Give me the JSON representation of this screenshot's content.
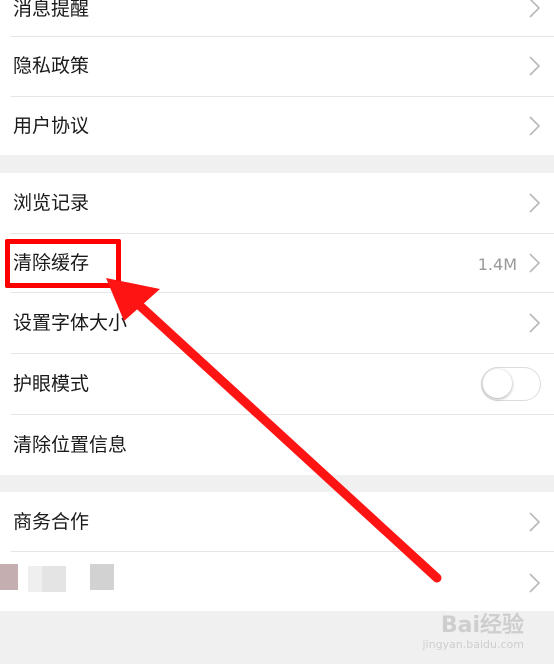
{
  "settings": {
    "group1": [
      {
        "label": "消息提醒"
      },
      {
        "label": "隐私政策"
      },
      {
        "label": "用户协议"
      }
    ],
    "group2": [
      {
        "label": "浏览记录"
      },
      {
        "label": "清除缓存",
        "value": "1.4M"
      },
      {
        "label": "设置字体大小"
      },
      {
        "label": "护眼模式",
        "toggle": false
      },
      {
        "label": "清除位置信息"
      }
    ],
    "group3": [
      {
        "label": "商务合作"
      },
      {
        "label": ""
      }
    ]
  },
  "annotation": {
    "color": "#ff0000"
  },
  "watermark": {
    "text": "Bai经验",
    "sub": "jingyan.baidu.com"
  }
}
